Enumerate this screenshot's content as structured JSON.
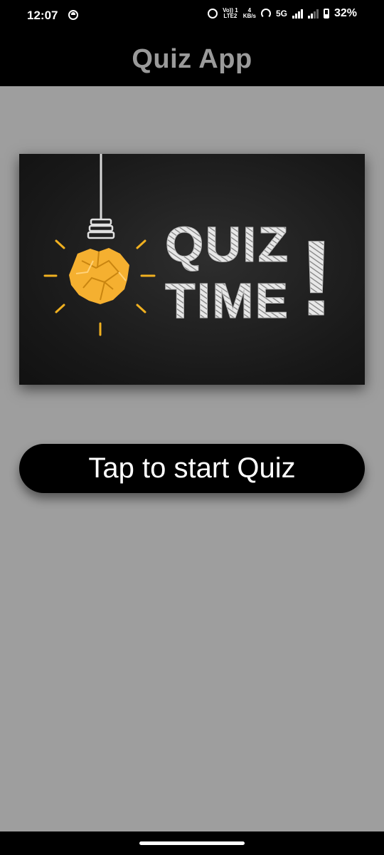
{
  "status_bar": {
    "time": "12:07",
    "volte_top": "Vo)) 1",
    "volte_bottom": "LTE2",
    "speed_top": "4",
    "speed_bottom": "KB/s",
    "network": "5G",
    "battery_percent": "32%"
  },
  "app_bar": {
    "title": "Quiz App"
  },
  "banner": {
    "icon": "crumpled-paper-lightbulb-icon",
    "line1": "QUIZ",
    "line2": "TIME",
    "exclamation": "!",
    "colors": {
      "chalk": "#e6e6e6",
      "bulb": "#f5b030",
      "rays": "#f0b020",
      "board": "#1c1c1c"
    }
  },
  "main": {
    "start_button_label": "Tap to start Quiz"
  },
  "colors": {
    "background": "#9e9e9e",
    "bars": "#000000",
    "title": "#9a9a9a"
  }
}
